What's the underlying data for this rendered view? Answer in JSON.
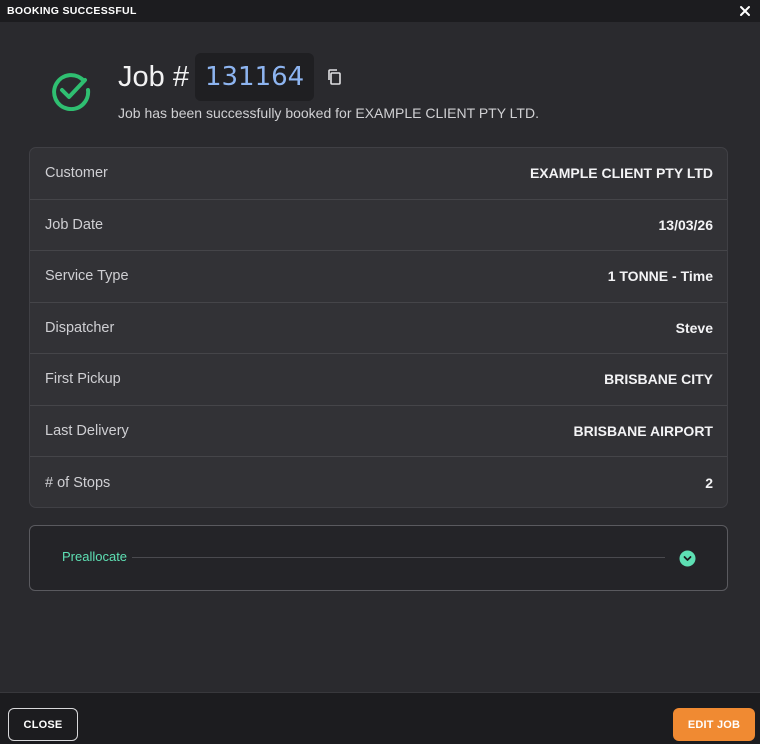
{
  "window": {
    "title": "BOOKING SUCCESSFUL"
  },
  "header": {
    "job_label": "Job #",
    "job_number": "131164",
    "subtitle": "Job has been successfully booked for EXAMPLE CLIENT PTY LTD."
  },
  "details": [
    {
      "label": "Customer",
      "value": "EXAMPLE CLIENT PTY LTD"
    },
    {
      "label": "Job Date",
      "value": "13/03/26"
    },
    {
      "label": "Service Type",
      "value": "1 TONNE - Time"
    },
    {
      "label": "Dispatcher",
      "value": "Steve"
    },
    {
      "label": "First Pickup",
      "value": "BRISBANE CITY"
    },
    {
      "label": "Last Delivery",
      "value": "BRISBANE AIRPORT"
    },
    {
      "label": "# of Stops",
      "value": "2"
    }
  ],
  "preallocate": {
    "label": "Preallocate"
  },
  "footer": {
    "close_label": "CLOSE",
    "edit_label": "EDIT JOB"
  },
  "colors": {
    "accent_success": "#2fbf71",
    "job_number": "#8db4f0",
    "preallocate": "#5ee0b4",
    "edit_button": "#f08a32"
  },
  "icons": {
    "success": "check-circle-icon",
    "copy": "copy-icon",
    "close": "close-icon",
    "expand": "chevron-down-icon"
  }
}
